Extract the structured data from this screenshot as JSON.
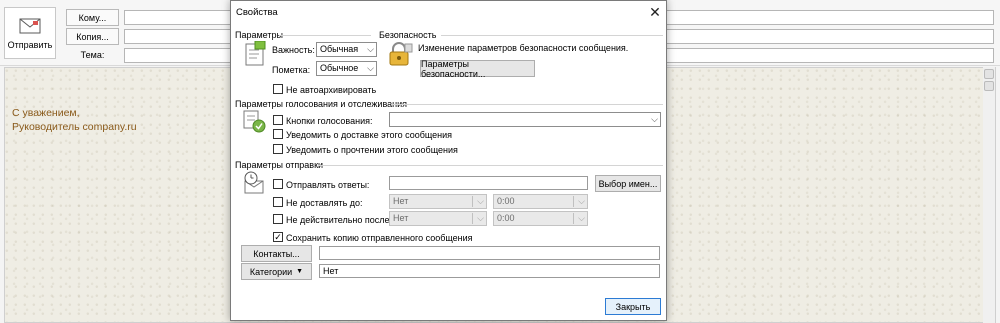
{
  "compose": {
    "send_label": "Отправить",
    "to_button": "Кому...",
    "cc_button": "Копия...",
    "subject_label": "Тема:",
    "to_value": "",
    "cc_value": "",
    "subject_value": ""
  },
  "signature": {
    "line1": "С уважением,",
    "line2": "Руководитель company.ru"
  },
  "dialog": {
    "title": "Свойства",
    "close_glyph": "✕",
    "params": {
      "title": "Параметры",
      "importance_label": "Важность:",
      "importance_value": "Обычная",
      "sensitivity_label": "Пометка:",
      "sensitivity_value": "Обычное",
      "no_autoarchive_label": "Не автоархивировать",
      "no_autoarchive_checked": false
    },
    "security": {
      "title": "Безопасность",
      "description": "Изменение параметров безопасности сообщения.",
      "button": "Параметры безопасности..."
    },
    "voting": {
      "title": "Параметры голосования и отслеживания",
      "voting_buttons_label": "Кнопки голосования:",
      "voting_buttons_value": "",
      "delivery_receipt_label": "Уведомить о доставке этого сообщения",
      "read_receipt_label": "Уведомить о прочтении этого сообщения"
    },
    "delivery": {
      "title": "Параметры отправки",
      "reply_to_label": "Отправлять ответы:",
      "reply_to_value": "",
      "select_names_button": "Выбор имен...",
      "defer_label": "Не доставлять до:",
      "defer_date": "Нет",
      "defer_time": "0:00",
      "expires_label": "Не действительно после:",
      "expires_date": "Нет",
      "expires_time": "0:00",
      "save_copy_label": "Сохранить копию отправленного сообщения",
      "save_copy_checked": true,
      "contacts_button": "Контакты...",
      "contacts_value": "",
      "categories_button": "Категории",
      "categories_value": "Нет"
    },
    "close_button": "Закрыть"
  },
  "colors": {
    "signature_text": "#8a5a1a",
    "primary_button_border": "#2c7bd4"
  }
}
